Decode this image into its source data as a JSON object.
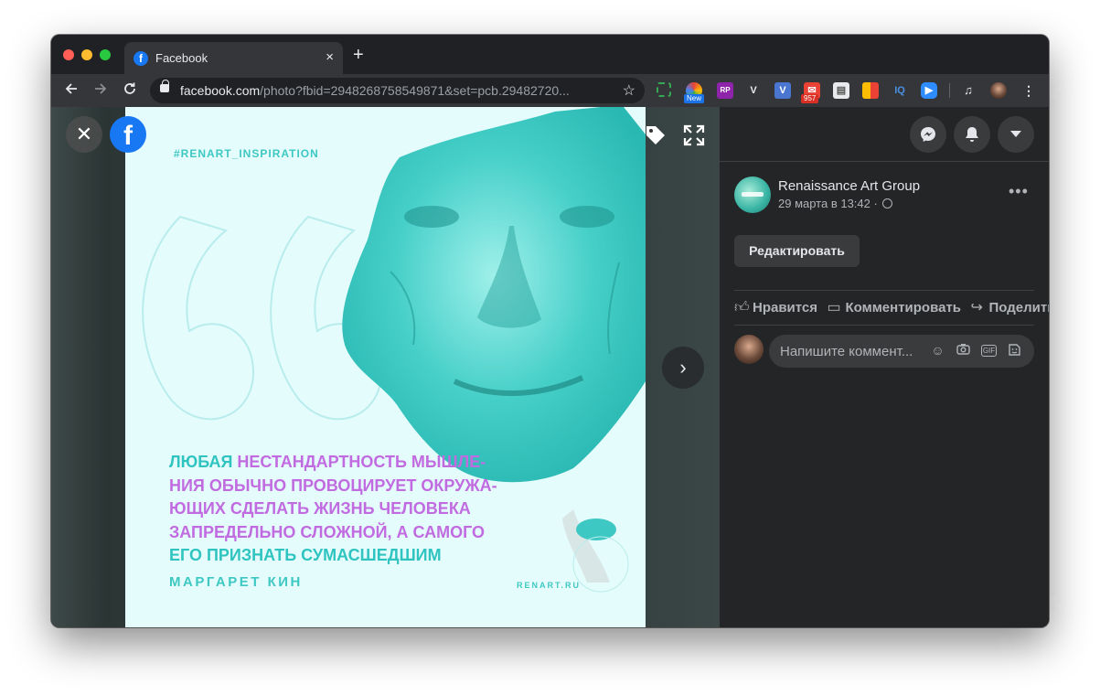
{
  "browser": {
    "tab_title": "Facebook",
    "tab_close": "×",
    "new_tab": "+",
    "url_host": "facebook.com",
    "url_path": "/photo?fbid=2948268758549871&set=pcb.29482720...",
    "extensions": {
      "new_badge": "New",
      "rp_label": "RP",
      "v_label": "V",
      "mail_count": "957",
      "iq_label": "IQ"
    }
  },
  "photo": {
    "hashtag": "#RENART_INSPIRATION",
    "quote_lines": [
      {
        "teal": "ЛЮБАЯ ",
        "purple": "НЕСТАНДАРТНОСТЬ МЫШЛЕ-"
      },
      {
        "purple": "НИЯ ОБЫЧНО ПРОВОЦИРУЕТ ОКРУЖА-"
      },
      {
        "purple": "ЮЩИХ СДЕЛАТЬ ЖИЗНЬ ЧЕЛОВЕКА"
      },
      {
        "purple": "ЗАПРЕДЕЛЬНО СЛОЖНОЙ, А САМОГО"
      },
      {
        "teal": "ЕГО ПРИЗНАТЬ СУМАСШЕДШИМ"
      }
    ],
    "author": "МАРГАРЕТ КИН",
    "site": "RENART.RU"
  },
  "viewer": {
    "close_glyph": "✕",
    "fb_logo_letter": "f",
    "next_glyph": "›"
  },
  "side": {
    "post_author": "Renaissance Art Group",
    "post_date": "29 марта в 13:42 ·",
    "more_glyph": "•••",
    "edit_label": "Редактировать",
    "actions": {
      "like": "Нравится",
      "comment": "Комментировать",
      "share": "Поделиться"
    },
    "comment_placeholder": "Напишите коммент..."
  },
  "colors": {
    "accent_teal": "#2fc4c0",
    "accent_purple": "#c16be0",
    "facebook_blue": "#1877f2"
  },
  "icons": [
    "back-arrow-icon",
    "forward-arrow-icon",
    "reload-icon",
    "lock-icon",
    "star-icon",
    "messenger-icon",
    "bell-icon",
    "caret-down-icon",
    "tag-icon",
    "expand-icon",
    "like-icon",
    "comment-icon",
    "share-icon",
    "emoji-icon",
    "camera-icon",
    "gif-icon",
    "sticker-icon",
    "globe-icon",
    "kebab-menu-icon"
  ]
}
